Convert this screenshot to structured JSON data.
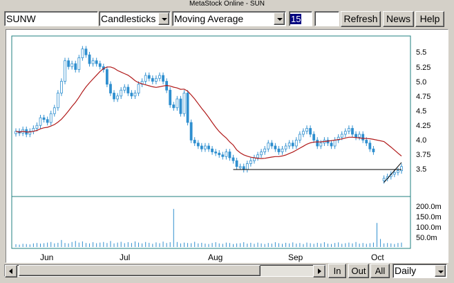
{
  "window": {
    "title": "MetaStock Online - SUN"
  },
  "toolbar": {
    "symbol": "SUNW",
    "chart_type": "Candlesticks",
    "indicator": "Moving Average",
    "period": "15",
    "extra_value": "",
    "refresh_label": "Refresh",
    "news_label": "News",
    "help_label": "Help"
  },
  "price_axis": {
    "labels": [
      "5.5",
      "5.25",
      "5.0",
      "4.75",
      "4.5",
      "4.25",
      "4.0",
      "3.75",
      "3.5"
    ]
  },
  "volume_axis": {
    "labels": [
      "200.0m",
      "150.0m",
      "100.0m",
      "50.0m"
    ]
  },
  "time_axis": {
    "labels": [
      "Jun",
      "Jul",
      "Aug",
      "Sep",
      "Oct"
    ]
  },
  "bottom_bar": {
    "in_label": "In",
    "out_label": "Out",
    "all_label": "All",
    "range_value": "Daily"
  },
  "colors": {
    "candle": "#2f8fcf",
    "moving_average": "#b01818",
    "trendline": "#000000",
    "frame": "#1f7f7f"
  },
  "chart_data": {
    "type": "candlestick",
    "title": "",
    "indicator": {
      "name": "Moving Average",
      "period": 15
    },
    "ylim": [
      3.3,
      5.6
    ],
    "volume_ylim": [
      0,
      220
    ],
    "x_tick_labels": [
      "Jun",
      "Jul",
      "Aug",
      "Sep",
      "Oct"
    ],
    "closes": [
      4.15,
      4.12,
      4.18,
      4.1,
      4.15,
      4.2,
      4.25,
      4.38,
      4.35,
      4.3,
      4.45,
      4.55,
      4.8,
      5.0,
      5.35,
      5.25,
      5.3,
      5.2,
      5.4,
      5.55,
      5.45,
      5.3,
      5.35,
      5.3,
      5.25,
      5.2,
      4.95,
      4.8,
      4.7,
      4.75,
      4.85,
      4.9,
      4.8,
      4.75,
      4.8,
      4.95,
      5.0,
      5.1,
      5.05,
      5.0,
      5.05,
      5.1,
      5.0,
      4.85,
      4.6,
      4.55,
      4.7,
      4.45,
      4.8,
      4.3,
      4.0,
      3.95,
      3.9,
      3.85,
      3.9,
      3.85,
      3.8,
      3.78,
      3.75,
      3.72,
      3.8,
      3.7,
      3.65,
      3.55,
      3.55,
      3.5,
      3.6,
      3.65,
      3.7,
      3.75,
      3.8,
      3.85,
      3.95,
      3.9,
      3.85,
      3.8,
      3.85,
      3.9,
      3.95,
      3.9,
      4.0,
      4.1,
      4.15,
      4.2,
      4.1,
      4.0,
      3.9,
      3.95,
      4.0,
      3.95,
      3.9,
      4.0,
      4.05,
      4.1,
      4.15,
      4.2,
      4.1,
      4.05,
      4.1,
      4.0,
      3.95,
      3.85,
      3.8,
      null,
      null,
      3.35,
      3.38,
      3.42,
      3.45,
      3.48,
      3.55
    ],
    "trendline_level": 3.5,
    "volume_m": [
      14,
      12,
      16,
      15,
      13,
      18,
      20,
      17,
      19,
      22,
      25,
      18,
      21,
      35,
      20,
      18,
      25,
      30,
      22,
      28,
      20,
      18,
      24,
      19,
      22,
      25,
      20,
      30,
      18,
      22,
      26,
      19,
      24,
      20,
      28,
      22,
      18,
      25,
      21,
      16,
      23,
      19,
      27,
      20,
      24,
      190,
      25,
      18,
      22,
      20,
      19,
      26,
      18,
      21,
      17,
      15,
      20,
      24,
      18,
      16,
      22,
      20,
      15,
      18,
      19,
      24,
      17,
      21,
      16,
      22,
      18,
      15,
      20,
      17,
      24,
      19,
      16,
      21,
      18,
      23,
      17,
      20,
      15,
      22,
      19,
      16,
      21,
      18,
      24,
      17,
      15,
      20,
      23,
      16,
      19,
      22,
      18,
      25,
      17,
      20,
      16,
      19,
      22,
      120,
      40,
      18,
      20,
      18,
      15,
      20,
      22,
      18,
      32
    ]
  }
}
